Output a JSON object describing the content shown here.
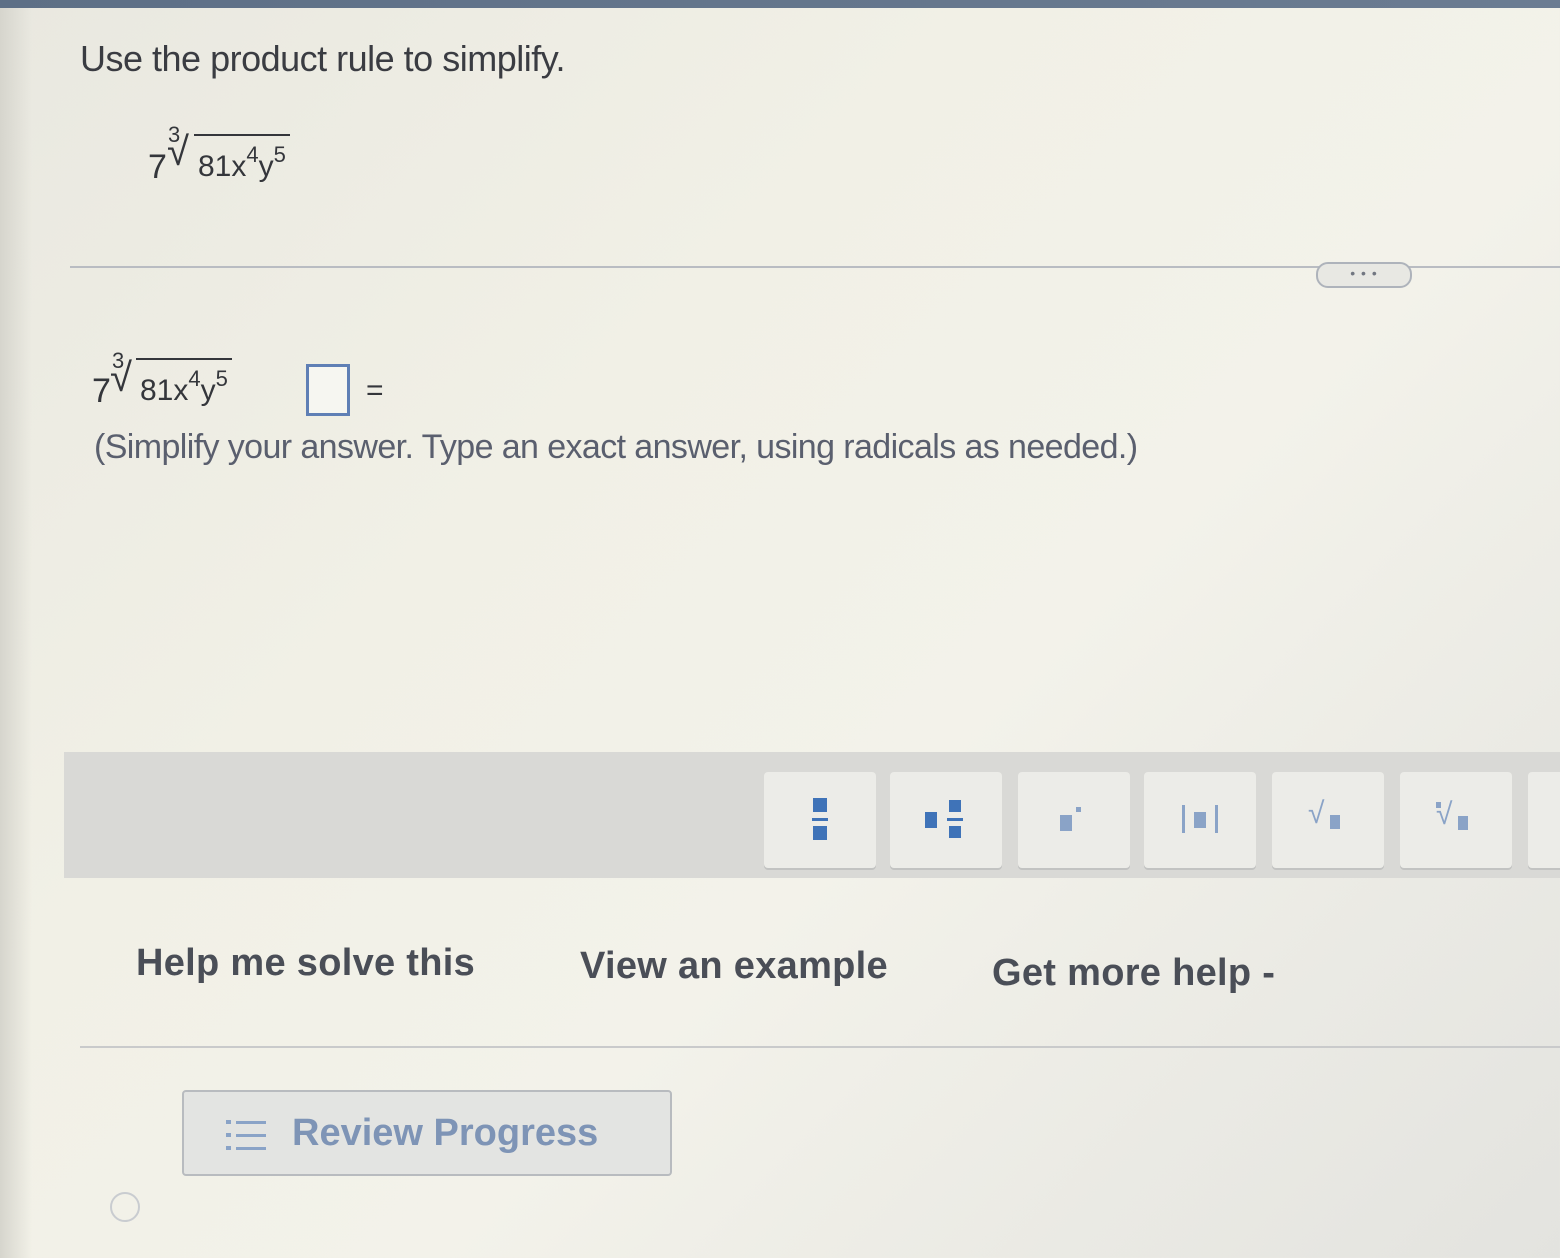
{
  "question": {
    "instruction": "Use the product rule to simplify.",
    "expression": {
      "coefficient": "7",
      "index": "3",
      "radicand_number": "81x",
      "x_exp": "4",
      "y_base": "y",
      "y_exp": "5"
    }
  },
  "more_button": {
    "label": "• • •"
  },
  "answer": {
    "equals": "=",
    "value": "",
    "note": "(Simplify your answer. Type an exact answer, using radicals as needed.)"
  },
  "toolbar": {
    "tools": [
      {
        "name": "fraction",
        "icon": "fraction-icon"
      },
      {
        "name": "mixed-number",
        "icon": "mixed-number-icon"
      },
      {
        "name": "exponent",
        "icon": "exponent-icon"
      },
      {
        "name": "absolute-value",
        "icon": "absolute-value-icon"
      },
      {
        "name": "square-root",
        "icon": "square-root-icon"
      },
      {
        "name": "nth-root",
        "icon": "nth-root-icon"
      }
    ]
  },
  "help": {
    "help_me_solve": "Help me solve this",
    "view_example": "View an example",
    "get_more_help": "Get more help -"
  },
  "review": {
    "label": "Review Progress"
  },
  "colors": {
    "accent": "#3f73b8",
    "answer_box_border": "#5f7fb5",
    "text": "#3a3c42"
  }
}
